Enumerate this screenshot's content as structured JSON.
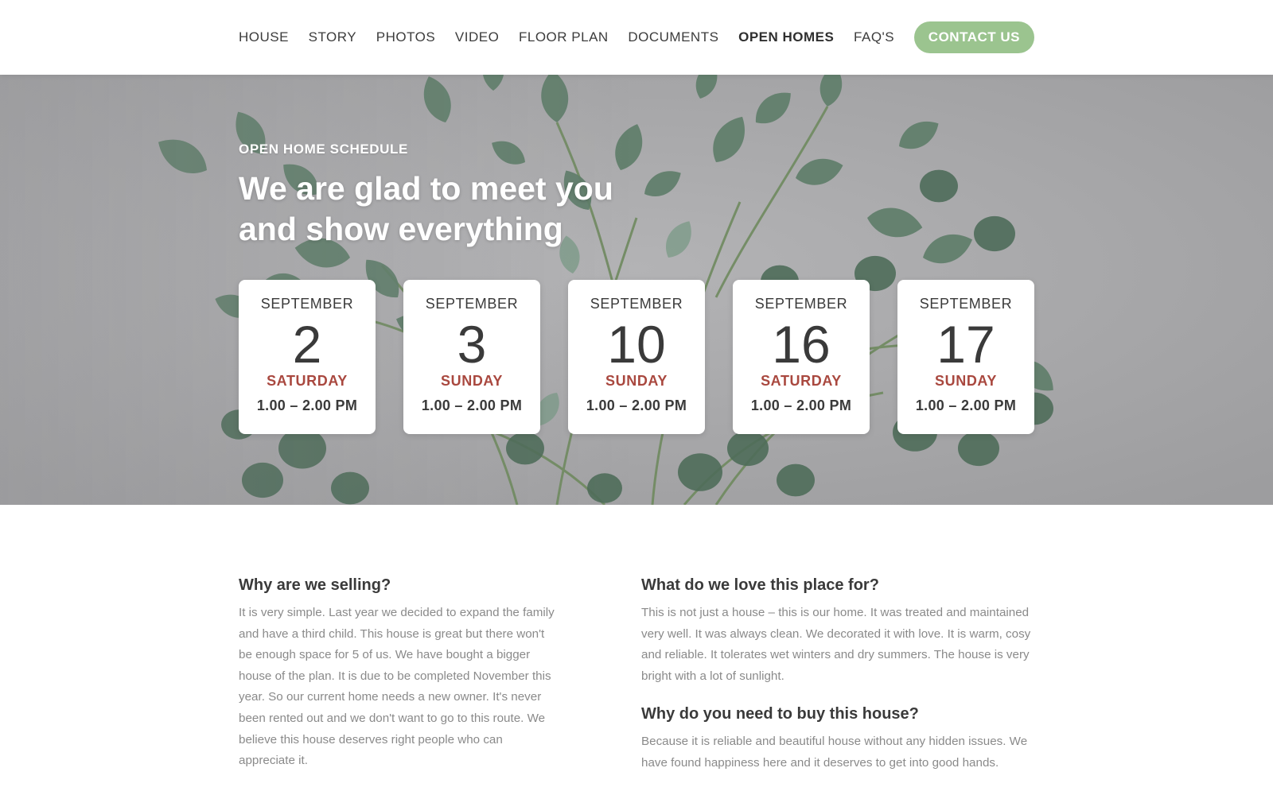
{
  "nav": {
    "items": [
      {
        "label": "HOUSE",
        "name": "nav-house",
        "active": false
      },
      {
        "label": "STORY",
        "name": "nav-story",
        "active": false
      },
      {
        "label": "PHOTOS",
        "name": "nav-photos",
        "active": false
      },
      {
        "label": "VIDEO",
        "name": "nav-video",
        "active": false
      },
      {
        "label": "FLOOR PLAN",
        "name": "nav-floor-plan",
        "active": false
      },
      {
        "label": "DOCUMENTS",
        "name": "nav-documents",
        "active": false
      },
      {
        "label": "OPEN HOMES",
        "name": "nav-open-homes",
        "active": true
      },
      {
        "label": "FAQ'S",
        "name": "nav-faqs",
        "active": false
      }
    ],
    "contact_label": "CONTACT US"
  },
  "hero": {
    "eyebrow": "OPEN HOME SCHEDULE",
    "headline_line1": "We are glad to meet you",
    "headline_line2": "and show everything",
    "dates": [
      {
        "month": "SEPTEMBER",
        "day": "2",
        "weekday": "SATURDAY",
        "time": "1.00 – 2.00 PM"
      },
      {
        "month": "SEPTEMBER",
        "day": "3",
        "weekday": "SUNDAY",
        "time": "1.00 – 2.00 PM"
      },
      {
        "month": "SEPTEMBER",
        "day": "10",
        "weekday": "SUNDAY",
        "time": "1.00 – 2.00 PM"
      },
      {
        "month": "SEPTEMBER",
        "day": "16",
        "weekday": "SATURDAY",
        "time": "1.00 – 2.00 PM"
      },
      {
        "month": "SEPTEMBER",
        "day": "17",
        "weekday": "SUNDAY",
        "time": "1.00 – 2.00 PM"
      }
    ]
  },
  "content": {
    "left": {
      "title": "Why are we selling?",
      "body": "It is very simple. Last year we decided to expand the family and have a third child. This house is great but there won't be enough space for 5 of us. We have bought a bigger house of the plan. It is due to be completed November this year. So our current home needs a new owner. It's never been rented out and we don't want to go to this route. We believe this house deserves right people who can appreciate it."
    },
    "right": [
      {
        "title": "What do we love this place for?",
        "body": "This is not just a house – this is our home. It was treated and maintained very well. It was always clean. We decorated it with love. It is warm, cosy and reliable. It tolerates wet winters and dry summers. The house is very bright with a lot of sunlight."
      },
      {
        "title": "Why do you need to buy this house?",
        "body": "Because it is reliable and beautiful house without any hidden issues. We have found happiness here and it deserves to get into good hands."
      }
    ]
  },
  "colors": {
    "accent_green": "#9bc48f",
    "weekday_red": "#a9483f",
    "hero_background": "#a8a8aa",
    "foliage": "#5f7e6a"
  }
}
